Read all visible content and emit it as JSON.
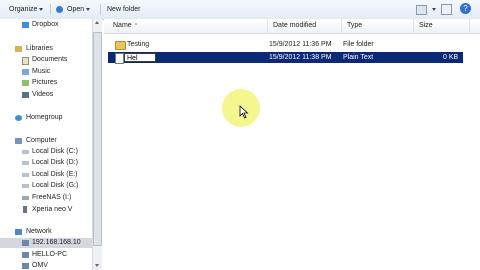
{
  "toolbar": {
    "organize": "Organize",
    "open": "Open",
    "new_folder": "New folder"
  },
  "nav": {
    "items": [
      {
        "label": "Dropbox",
        "icon": "dropbox-icon"
      },
      {
        "label": "Libraries",
        "icon": "libraries-icon"
      },
      {
        "label": "Documents",
        "icon": "documents-icon"
      },
      {
        "label": "Music",
        "icon": "music-icon"
      },
      {
        "label": "Pictures",
        "icon": "pictures-icon"
      },
      {
        "label": "Videos",
        "icon": "videos-icon"
      },
      {
        "label": "Homegroup",
        "icon": "homegroup-icon"
      },
      {
        "label": "Computer",
        "icon": "computer-icon"
      },
      {
        "label": "Local Disk (C:)",
        "icon": "drive-icon"
      },
      {
        "label": "Local Disk (D:)",
        "icon": "drive-icon"
      },
      {
        "label": "Local Disk (E:)",
        "icon": "drive-icon"
      },
      {
        "label": "Local Disk (G:)",
        "icon": "drive-icon"
      },
      {
        "label": "FreeNAS (I:)",
        "icon": "network-drive-icon"
      },
      {
        "label": "Xperia neo V",
        "icon": "phone-icon"
      },
      {
        "label": "Network",
        "icon": "network-icon"
      },
      {
        "label": "192.168.168.10",
        "icon": "network-computer-icon"
      },
      {
        "label": "HELLO-PC",
        "icon": "network-computer-icon"
      },
      {
        "label": "OMV",
        "icon": "network-computer-icon"
      }
    ]
  },
  "columns": {
    "name": "Name",
    "date": "Date modified",
    "type": "Type",
    "size": "Size"
  },
  "files": [
    {
      "name": "Testing",
      "date": "15/9/2012 11:36 PM",
      "type": "File folder",
      "size": ""
    },
    {
      "name": "Hel",
      "date": "15/9/2012 11:38 PM",
      "type": "Plain Text",
      "size": "0 KB"
    }
  ],
  "colors": {
    "selection": "#0a2a76",
    "cursor_highlight": "#f3f36a"
  }
}
